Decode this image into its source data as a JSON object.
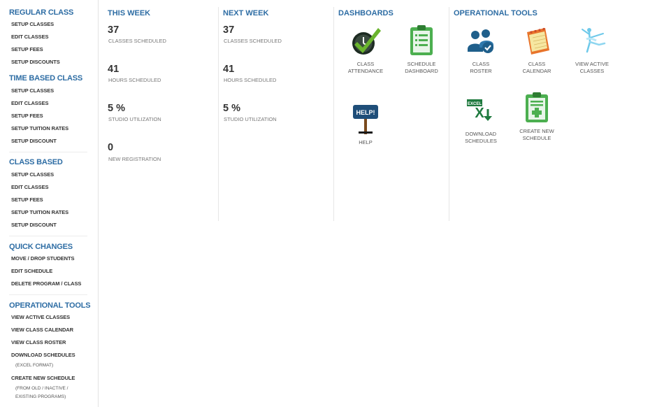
{
  "sidebar": {
    "regular": {
      "title": "REGULAR CLASS",
      "items": [
        "SETUP CLASSES",
        "EDIT CLASSES",
        "SETUP FEES",
        "SETUP DISCOUNTS"
      ]
    },
    "time_based": {
      "title": "TIME BASED CLASS",
      "items": [
        "SETUP CLASSES",
        "EDIT CLASSES",
        "SETUP FEES",
        "SETUP TUITION RATES",
        "SETUP DISCOUNT"
      ]
    },
    "class_based": {
      "title": "CLASS BASED",
      "items": [
        "SETUP CLASSES",
        "EDIT CLASSES",
        "SETUP FEES",
        "SETUP TUITION RATES",
        "SETUP DISCOUNT"
      ]
    },
    "quick_changes": {
      "title": "QUICK CHANGES",
      "items": [
        "MOVE / DROP STUDENTS",
        "EDIT SCHEDULE",
        "DELETE PROGRAM / CLASS"
      ]
    },
    "operational_tools": {
      "title": "OPERATIONAL TOOLS",
      "items": [
        "VIEW ACTIVE CLASSES",
        "VIEW CLASS CALENDAR",
        "VIEW CLASS ROSTER",
        "DOWNLOAD SCHEDULES",
        "CREATE NEW SCHEDULE"
      ],
      "notes": [
        "(EXCEL FORMAT)",
        "(FROM OLD / INACTIVE /",
        "EXISTING PROGRAMS)"
      ]
    }
  },
  "this_week": {
    "title": "THIS WEEK",
    "stats": [
      {
        "value": "37",
        "label": "CLASSES SCHEDULED"
      },
      {
        "value": "41",
        "label": "HOURS SCHEDULED"
      },
      {
        "value": "5 %",
        "label": "STUDIO UTILIZATION"
      },
      {
        "value": "0",
        "label": "NEW REGISTRATION"
      }
    ]
  },
  "next_week": {
    "title": "NEXT WEEK",
    "stats": [
      {
        "value": "37",
        "label": "CLASSES SCHEDULED"
      },
      {
        "value": "41",
        "label": "HOURS SCHEDULED"
      },
      {
        "value": "5 %",
        "label": "STUDIO UTILIZATION"
      }
    ]
  },
  "dashboards": {
    "title": "DASHBOARDS",
    "tiles": [
      {
        "label": "CLASS\nATTENDANCE",
        "icon": "clock-check-icon"
      },
      {
        "label": "SCHEDULE\nDASHBOARD",
        "icon": "clipboard-icon"
      },
      {
        "label": "HELP",
        "icon": "help-sign-icon",
        "sign_text": "HELP!"
      }
    ]
  },
  "operational_tools": {
    "title": "OPERATIONAL TOOLS",
    "tiles": [
      {
        "label": "CLASS\nROSTER",
        "icon": "people-icon"
      },
      {
        "label": "CLASS\nCALENDAR",
        "icon": "calendar-icon"
      },
      {
        "label": "VIEW ACTIVE\nCLASSES",
        "icon": "dancer-icon"
      },
      {
        "label": "DOWNLOAD\nSCHEDULES",
        "icon": "excel-download-icon",
        "badge_text": "EXCEL"
      },
      {
        "label": "CREATE NEW\nSCHEDULE",
        "icon": "clipboard-add-icon"
      }
    ]
  },
  "colors": {
    "section_title": "#2e6da4",
    "green": "#4caf50",
    "dark_blue": "#1f5f8b"
  }
}
